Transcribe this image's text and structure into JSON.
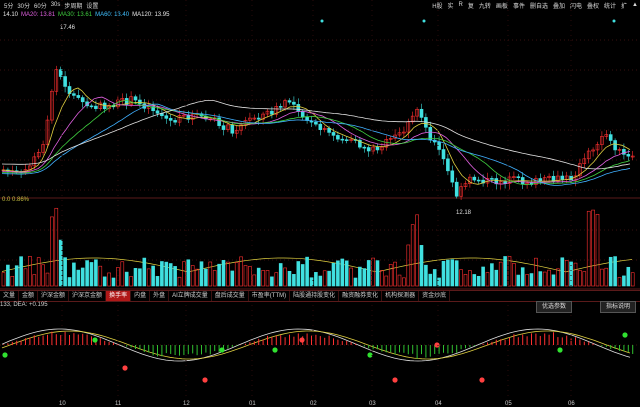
{
  "toolbar": {
    "left": [
      "5分",
      "30分",
      "60分",
      "30s",
      "步周期",
      "设置"
    ],
    "right": [
      "H股",
      "实",
      "R",
      "复",
      "九转",
      "画板",
      "事件",
      "删自选",
      "叠加",
      "闪电",
      "叠权",
      "统计",
      "扩 ",
      "▲"
    ]
  },
  "ma_legend": [
    {
      "label": "14.10",
      "color": "#e8e8e8"
    },
    {
      "label": "MA20: 13.81",
      "color": "#e060e0"
    },
    {
      "label": "MA30: 13.61",
      "color": "#40d040"
    },
    {
      "label": "MA60: 13.40",
      "color": "#40c0ff"
    },
    {
      "label": "MA120: 13.95",
      "color": "#e8e8e8"
    }
  ],
  "price_annotations": {
    "high": "17.46",
    "low": "12.18"
  },
  "volume_label": "0.0  0.86%",
  "tabs": [
    "文量",
    "金额",
    "沪深金额",
    "沪深京金额",
    "换手率",
    "内盘",
    "外盘",
    "AI立牌成交量",
    "盘后成交量",
    "市盈率(TTM)",
    "陆股通持股变化",
    "融资融券变化",
    "机构探测器",
    "资金炒底"
  ],
  "active_tab": "换手率",
  "buttons": {
    "select_params": "优选参数",
    "indicator_usage": "指标说明"
  },
  "macd_legend": "133, DEA: +0.195",
  "date_ticks": [
    "10",
    "11",
    "12",
    "01",
    "02",
    "03",
    "04",
    "05",
    "06"
  ],
  "colors": {
    "up": "#ff3030",
    "down": "#40e0e0",
    "ma_yellow": "#e0d040",
    "ma_purple": "#e060e0",
    "ma_green": "#40d040",
    "ma_blue": "#40b0ff",
    "ma_white": "#e0e0e0"
  }
}
